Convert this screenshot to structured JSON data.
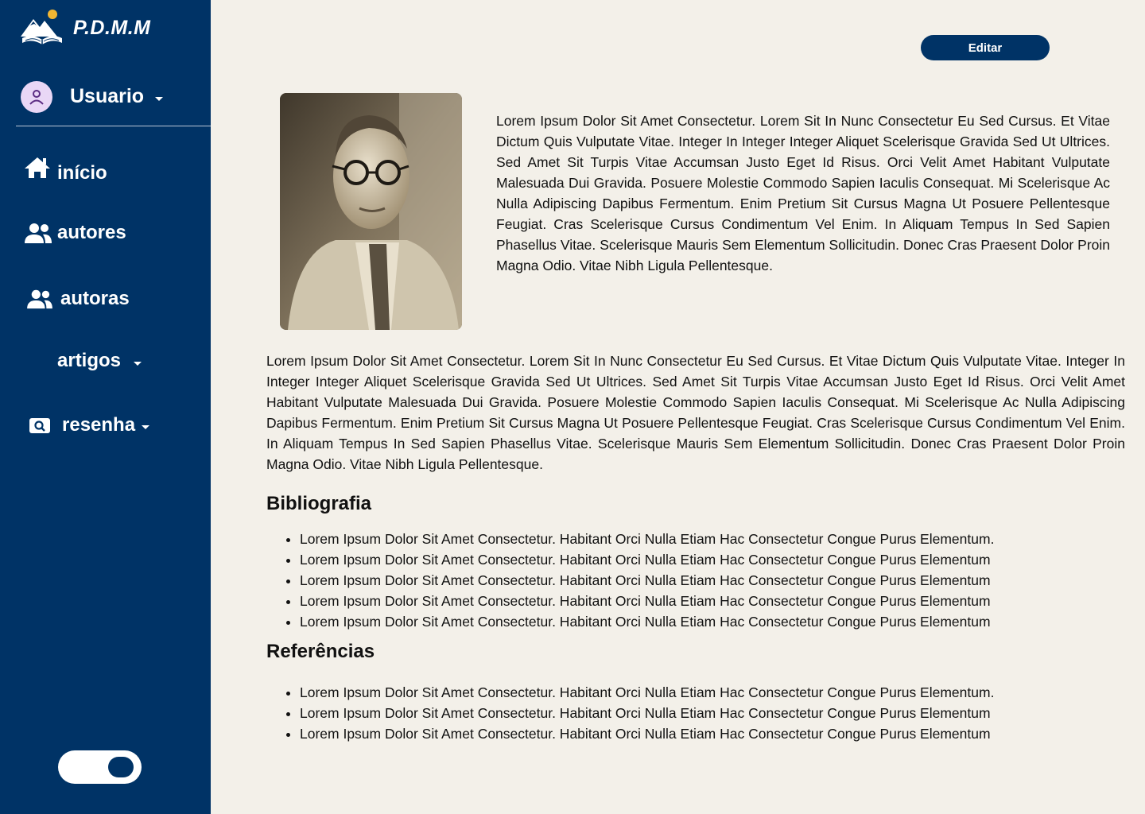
{
  "app": {
    "logo_text": "P.D.M.M"
  },
  "user": {
    "label": "Usuario"
  },
  "nav": {
    "inicio": "início",
    "autores": "autores",
    "autoras": "autoras",
    "artigos": "artigos",
    "resenha": "resenha"
  },
  "theme_toggle": {
    "state": "on"
  },
  "toolbar": {
    "edit_label": "Editar"
  },
  "content": {
    "intro": "Lorem Ipsum Dolor Sit Amet Consectetur. Lorem Sit In Nunc Consectetur Eu Sed Cursus. Et Vitae Dictum Quis Vulputate Vitae. Integer In Integer Integer Aliquet Scelerisque Gravida Sed Ut Ultrices. Sed Amet Sit Turpis Vitae Accumsan Justo Eget Id Risus. Orci Velit Amet Habitant Vulputate Malesuada Dui Gravida. Posuere Molestie Commodo Sapien Iaculis Consequat. Mi Scelerisque Ac Nulla Adipiscing Dapibus Fermentum. Enim Pretium Sit Cursus Magna Ut Posuere Pellentesque Feugiat. Cras Scelerisque Cursus Condimentum Vel Enim. In Aliquam Tempus In Sed Sapien Phasellus Vitae. Scelerisque Mauris Sem Elementum Sollicitudin. Donec Cras Praesent Dolor Proin Magna Odio. Vitae Nibh Ligula Pellentesque.",
    "body": "Lorem Ipsum Dolor Sit Amet Consectetur. Lorem Sit In Nunc Consectetur Eu Sed Cursus. Et Vitae Dictum Quis Vulputate Vitae. Integer In Integer Integer Aliquet Scelerisque Gravida Sed Ut Ultrices. Sed Amet Sit Turpis Vitae Accumsan Justo Eget Id Risus. Orci Velit Amet Habitant Vulputate Malesuada Dui Gravida. Posuere Molestie Commodo Sapien Iaculis Consequat. Mi Scelerisque Ac Nulla Adipiscing Dapibus Fermentum. Enim Pretium Sit Cursus Magna Ut Posuere Pellentesque Feugiat. Cras Scelerisque Cursus Condimentum Vel Enim. In Aliquam Tempus In Sed Sapien Phasellus Vitae. Scelerisque Mauris Sem Elementum Sollicitudin. Donec Cras Praesent Dolor Proin Magna Odio. Vitae Nibh Ligula Pellentesque.",
    "bibliografia_title": "Bibliografia",
    "bibliografia": [
      "Lorem Ipsum Dolor Sit Amet Consectetur. Habitant Orci Nulla Etiam Hac Consectetur Congue Purus Elementum.",
      "Lorem Ipsum Dolor Sit Amet Consectetur. Habitant Orci Nulla Etiam Hac Consectetur Congue Purus Elementum",
      "Lorem Ipsum Dolor Sit Amet Consectetur. Habitant Orci Nulla Etiam Hac Consectetur Congue Purus Elementum",
      "Lorem Ipsum Dolor Sit Amet Consectetur. Habitant Orci Nulla Etiam Hac Consectetur Congue Purus Elementum",
      "Lorem Ipsum Dolor Sit Amet Consectetur. Habitant Orci Nulla Etiam Hac Consectetur Congue Purus Elementum"
    ],
    "referencias_title": "Referências",
    "referencias": [
      "Lorem Ipsum Dolor Sit Amet Consectetur. Habitant Orci Nulla Etiam Hac Consectetur Congue Purus Elementum.",
      "Lorem Ipsum Dolor Sit Amet Consectetur. Habitant Orci Nulla Etiam Hac Consectetur Congue Purus Elementum",
      "Lorem Ipsum Dolor Sit Amet Consectetur. Habitant Orci Nulla Etiam Hac Consectetur Congue Purus Elementum"
    ]
  },
  "icons": {
    "logo": "book-mountain-sun-icon",
    "user": "user-avatar-icon",
    "inicio": "home-icon",
    "autores": "people-icon",
    "autoras": "people-icon",
    "resenha": "search-icon"
  },
  "colors": {
    "sidebar": "#003366",
    "background": "#f3f0e9",
    "accent": "#003366",
    "avatar_bg": "#e9d7f6"
  }
}
